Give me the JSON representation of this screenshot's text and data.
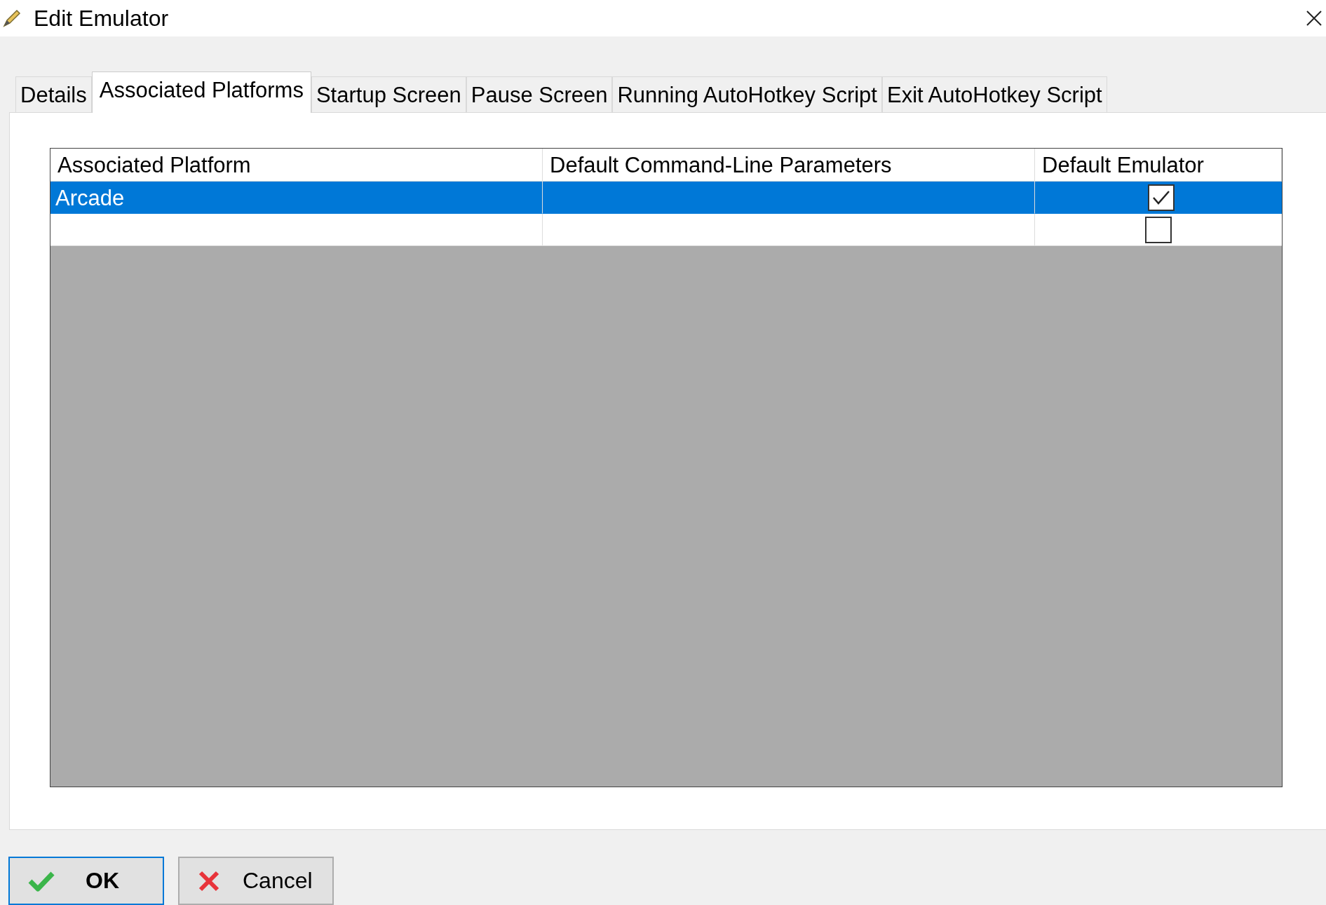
{
  "window": {
    "title": "Edit Emulator"
  },
  "tabs": [
    {
      "label": "Details",
      "selected": false
    },
    {
      "label": "Associated Platforms",
      "selected": true
    },
    {
      "label": "Startup Screen",
      "selected": false
    },
    {
      "label": "Pause Screen",
      "selected": false
    },
    {
      "label": "Running AutoHotkey Script",
      "selected": false
    },
    {
      "label": "Exit AutoHotkey Script",
      "selected": false
    }
  ],
  "table": {
    "columns": [
      "Associated Platform",
      "Default Command-Line Parameters",
      "Default Emulator"
    ],
    "rows": [
      {
        "platform": "Arcade",
        "default_emulator": true,
        "selected": true
      },
      {
        "default_emulator": false,
        "selected": false
      }
    ]
  },
  "buttons": [
    {
      "kind": "ok",
      "label": "OK",
      "focused": true
    },
    {
      "kind": "cancel",
      "label": "Cancel",
      "focused": false
    }
  ]
}
